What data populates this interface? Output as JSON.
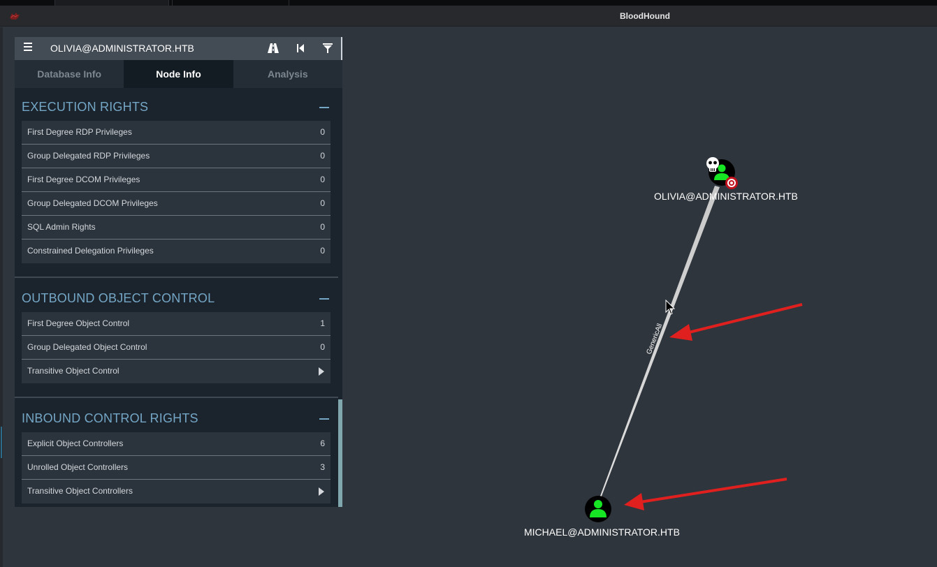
{
  "window": {
    "title": "BloodHound"
  },
  "search": {
    "node_name": "OLIVIA@ADMINISTRATOR.HTB"
  },
  "toolbar": {
    "menu_icon": "hamburger-icon",
    "path_icon": "road-icon",
    "back_icon": "skip-back-icon",
    "filter_icon": "filter-icon"
  },
  "tabs": [
    {
      "label": "Database Info",
      "active": false
    },
    {
      "label": "Node Info",
      "active": true
    },
    {
      "label": "Analysis",
      "active": false
    }
  ],
  "sections": {
    "execution": {
      "title": "EXECUTION RIGHTS",
      "rows": [
        {
          "label": "First Degree RDP Privileges",
          "value": "0"
        },
        {
          "label": "Group Delegated RDP Privileges",
          "value": "0"
        },
        {
          "label": "First Degree DCOM Privileges",
          "value": "0"
        },
        {
          "label": "Group Delegated DCOM Privileges",
          "value": "0"
        },
        {
          "label": "SQL Admin Rights",
          "value": "0"
        },
        {
          "label": "Constrained Delegation Privileges",
          "value": "0"
        }
      ]
    },
    "outbound": {
      "title": "OUTBOUND OBJECT CONTROL",
      "rows": [
        {
          "label": "First Degree Object Control",
          "value": "1"
        },
        {
          "label": "Group Delegated Object Control",
          "value": "0"
        },
        {
          "label": "Transitive Object Control",
          "value": ""
        }
      ]
    },
    "inbound": {
      "title": "INBOUND CONTROL RIGHTS",
      "rows": [
        {
          "label": "Explicit Object Controllers",
          "value": "6"
        },
        {
          "label": "Unrolled Object Controllers",
          "value": "3"
        },
        {
          "label": "Transitive Object Controllers",
          "value": ""
        }
      ]
    }
  },
  "graph": {
    "nodes": [
      {
        "label": "OLIVIA@ADMINISTRATOR.HTB",
        "type": "user",
        "owned": true,
        "target": true
      },
      {
        "label": "MICHAEL@ADMINISTRATOR.HTB",
        "type": "user",
        "owned": false,
        "target": false
      }
    ],
    "edge": {
      "label": "GenericAll"
    }
  },
  "colors": {
    "background": "#2f353c",
    "accent": "#74a6c6",
    "user_node": "#17e625",
    "annotation_arrow": "#e0201f"
  }
}
